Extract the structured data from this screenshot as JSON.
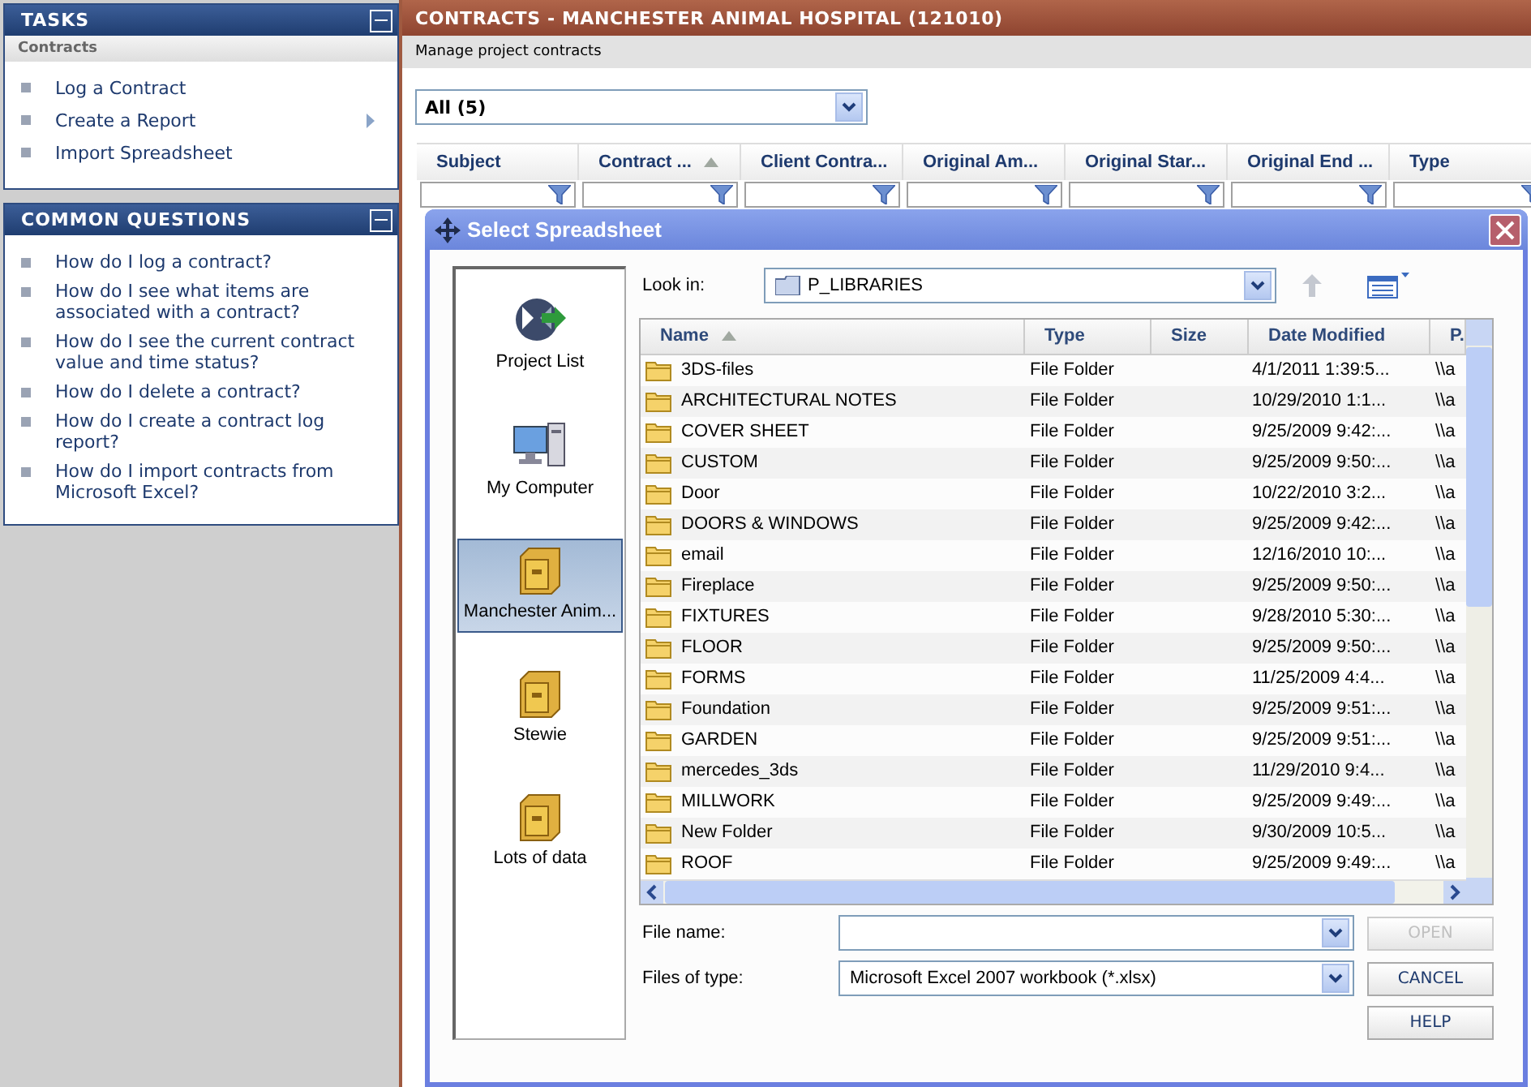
{
  "tasks": {
    "title": "TASKS",
    "section": "Contracts",
    "items": [
      {
        "label": "Log a Contract",
        "submenu": false
      },
      {
        "label": "Create a Report",
        "submenu": true
      },
      {
        "label": "Import Spreadsheet",
        "submenu": false
      }
    ]
  },
  "questions": {
    "title": "COMMON QUESTIONS",
    "items": [
      "How do I log a contract?",
      "How do I see what items are associated with a contract?",
      "How do I see the current contract value and time status?",
      "How do I delete a contract?",
      "How do I create a contract log report?",
      "How do I import contracts from Microsoft Excel?"
    ]
  },
  "main": {
    "title": "CONTRACTS - MANCHESTER ANIMAL HOSPITAL (121010)",
    "subtitle": "Manage project contracts",
    "filter": "All (5)",
    "columns": [
      {
        "label": "Subject",
        "sorted": false
      },
      {
        "label": "Contract ...",
        "sorted": true
      },
      {
        "label": "Client Contra...",
        "sorted": false
      },
      {
        "label": "Original Am...",
        "sorted": false
      },
      {
        "label": "Original Star...",
        "sorted": false
      },
      {
        "label": "Original End ...",
        "sorted": false
      },
      {
        "label": "Type",
        "sorted": false
      }
    ]
  },
  "dialog": {
    "title": "Select Spreadsheet",
    "places": [
      {
        "label": "Project List",
        "kind": "project",
        "selected": false
      },
      {
        "label": "My Computer",
        "kind": "computer",
        "selected": false
      },
      {
        "label": "Manchester Anim...",
        "kind": "cabinet",
        "selected": true
      },
      {
        "label": "Stewie",
        "kind": "cabinet",
        "selected": false
      },
      {
        "label": "Lots of data",
        "kind": "cabinet",
        "selected": false
      }
    ],
    "look_in_label": "Look in:",
    "look_in": "P_LIBRARIES",
    "columns": [
      {
        "label": "Name",
        "sorted": true
      },
      {
        "label": "Type",
        "sorted": false
      },
      {
        "label": "Size",
        "sorted": false
      },
      {
        "label": "Date Modified",
        "sorted": false
      },
      {
        "label": "P.",
        "sorted": false
      }
    ],
    "rows": [
      {
        "name": "3DS-files",
        "type": "File Folder",
        "date": "4/1/2011 1:39:5...",
        "column_5": "\\\\a"
      },
      {
        "name": "ARCHITECTURAL NOTES",
        "type": "File Folder",
        "date": "10/29/2010 1:1...",
        "column_5": "\\\\a"
      },
      {
        "name": "COVER SHEET",
        "type": "File Folder",
        "date": "9/25/2009 9:42:...",
        "column_5": "\\\\a"
      },
      {
        "name": "CUSTOM",
        "type": "File Folder",
        "date": "9/25/2009 9:50:...",
        "column_5": "\\\\a"
      },
      {
        "name": "Door",
        "type": "File Folder",
        "date": "10/22/2010 3:2...",
        "column_5": "\\\\a"
      },
      {
        "name": "DOORS & WINDOWS",
        "type": "File Folder",
        "date": "9/25/2009 9:42:...",
        "column_5": "\\\\a"
      },
      {
        "name": "email",
        "type": "File Folder",
        "date": "12/16/2010 10:...",
        "column_5": "\\\\a"
      },
      {
        "name": "Fireplace",
        "type": "File Folder",
        "date": "9/25/2009 9:50:...",
        "column_5": "\\\\a"
      },
      {
        "name": "FIXTURES",
        "type": "File Folder",
        "date": "9/28/2010 5:30:...",
        "column_5": "\\\\a"
      },
      {
        "name": "FLOOR",
        "type": "File Folder",
        "date": "9/25/2009 9:50:...",
        "column_5": "\\\\a"
      },
      {
        "name": "FORMS",
        "type": "File Folder",
        "date": "11/25/2009 4:4...",
        "column_5": "\\\\a"
      },
      {
        "name": "Foundation",
        "type": "File Folder",
        "date": "9/25/2009 9:51:...",
        "column_5": "\\\\a"
      },
      {
        "name": "GARDEN",
        "type": "File Folder",
        "date": "9/25/2009 9:51:...",
        "column_5": "\\\\a"
      },
      {
        "name": "mercedes_3ds",
        "type": "File Folder",
        "date": "11/29/2010 9:4...",
        "column_5": "\\\\a"
      },
      {
        "name": "MILLWORK",
        "type": "File Folder",
        "date": "9/25/2009 9:49:...",
        "column_5": "\\\\a"
      },
      {
        "name": "New Folder",
        "type": "File Folder",
        "date": "9/30/2009 10:5...",
        "column_5": "\\\\a"
      },
      {
        "name": "ROOF",
        "type": "File Folder",
        "date": "9/25/2009 9:49:...",
        "column_5": "\\\\a"
      }
    ],
    "file_name_label": "File name:",
    "file_type_label": "Files of type:",
    "file_type": "Microsoft Excel 2007 workbook (*.xlsx)",
    "buttons": [
      {
        "label": "OPEN",
        "disabled": true
      },
      {
        "label": "CANCEL",
        "disabled": false
      },
      {
        "label": "HELP",
        "disabled": false
      }
    ]
  }
}
